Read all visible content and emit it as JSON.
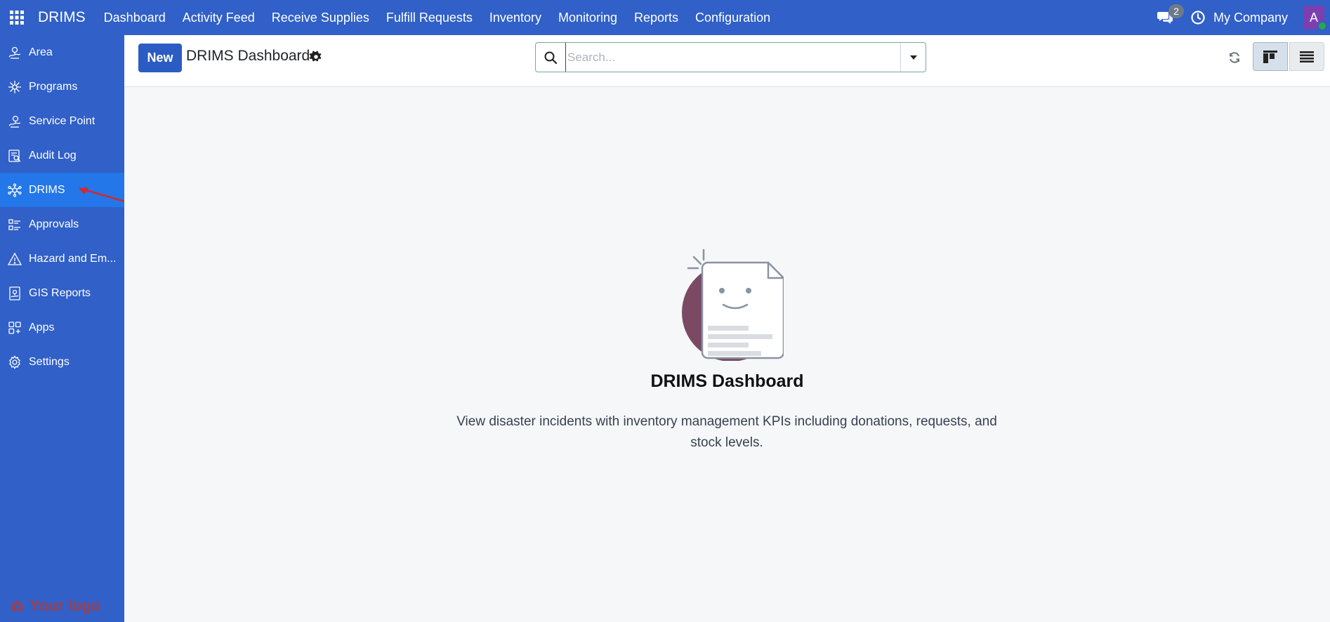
{
  "navbar": {
    "brand": "DRIMS",
    "menu": [
      "Dashboard",
      "Activity Feed",
      "Receive Supplies",
      "Fulfill Requests",
      "Inventory",
      "Monitoring",
      "Reports",
      "Configuration"
    ],
    "chat_count": "2",
    "company": "My Company",
    "avatar_initial": "A"
  },
  "sidebar": {
    "items": [
      {
        "label": "Area",
        "icon": "area-icon"
      },
      {
        "label": "Programs",
        "icon": "programs-icon"
      },
      {
        "label": "Service Point",
        "icon": "service-point-icon"
      },
      {
        "label": "Audit Log",
        "icon": "audit-log-icon"
      },
      {
        "label": "DRIMS",
        "icon": "drims-icon",
        "active": true
      },
      {
        "label": "Approvals",
        "icon": "approvals-icon"
      },
      {
        "label": "Hazard and Em...",
        "icon": "hazard-icon"
      },
      {
        "label": "GIS Reports",
        "icon": "gis-reports-icon"
      },
      {
        "label": "Apps",
        "icon": "apps-icon"
      },
      {
        "label": "Settings",
        "icon": "settings-icon"
      }
    ],
    "logo_text": "Your logo"
  },
  "control_panel": {
    "new_label": "New",
    "title": "DRIMS Dashboard",
    "search_placeholder": "Search..."
  },
  "main": {
    "helper_title": "DRIMS Dashboard",
    "helper_text": "View disaster incidents with inventory management KPIs including donations, requests, and stock levels."
  },
  "colors": {
    "navbar": "#3060c8",
    "sidebar_active": "#2377e8",
    "primary_button": "#2b5cc4",
    "illustration_circle": "#7a4a64"
  }
}
